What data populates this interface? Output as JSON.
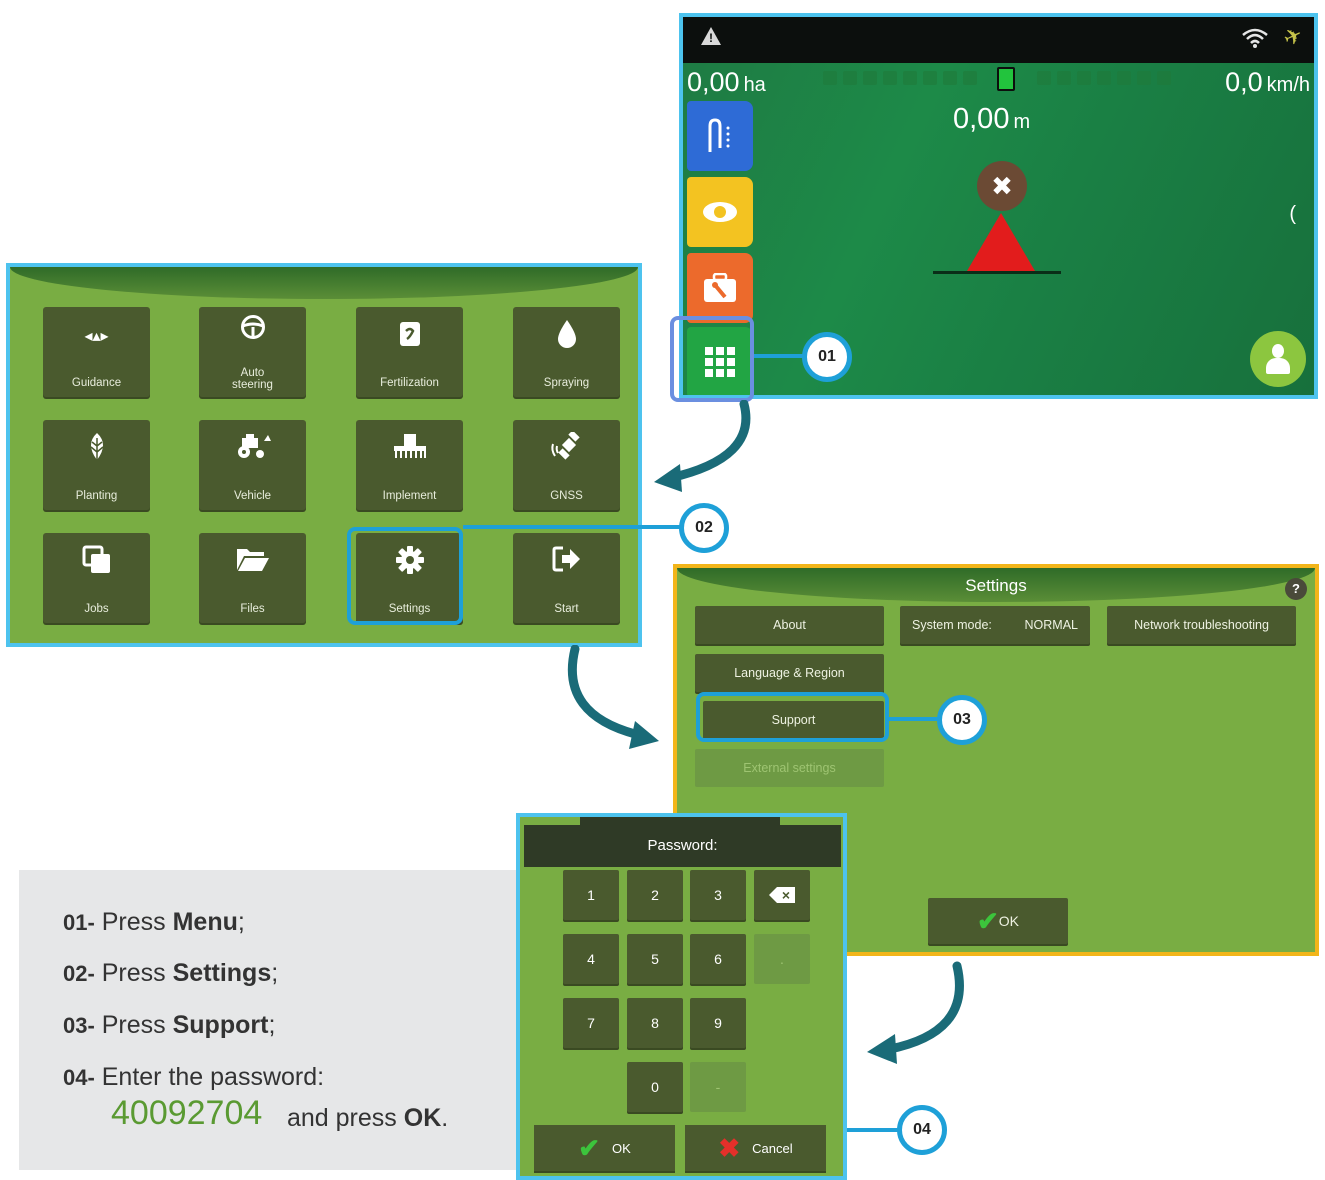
{
  "screen1": {
    "area_value": "0,00",
    "area_unit": "ha",
    "speed_value": "0,0",
    "speed_unit": "km/h",
    "crosstrack_value": "0,00",
    "crosstrack_unit": "m",
    "icons": [
      "warning-icon",
      "wifi-icon",
      "satellite-icon",
      "guidance-pattern-icon",
      "eye-icon",
      "toolbox-icon",
      "menu-grid-icon",
      "cancel-icon",
      "vehicle-triangle-icon",
      "operator-icon"
    ]
  },
  "menu": {
    "tiles": [
      {
        "label": "Guidance",
        "icon": "guidance-icon"
      },
      {
        "label": "Auto\nsteering",
        "icon": "steering-wheel-icon"
      },
      {
        "label": "Fertilization",
        "icon": "fertilizer-bag-icon"
      },
      {
        "label": "Spraying",
        "icon": "droplet-icon"
      },
      {
        "label": "Planting",
        "icon": "leaf-icon"
      },
      {
        "label": "Vehicle",
        "icon": "tractor-icon"
      },
      {
        "label": "Implement",
        "icon": "implement-icon"
      },
      {
        "label": "GNSS",
        "icon": "satellite-icon"
      },
      {
        "label": "Jobs",
        "icon": "jobs-icon"
      },
      {
        "label": "Files",
        "icon": "folder-icon"
      },
      {
        "label": "Settings",
        "icon": "gear-icon"
      },
      {
        "label": "Start",
        "icon": "exit-icon"
      }
    ]
  },
  "settings": {
    "title": "Settings",
    "help": "?",
    "about": "About",
    "system_mode_label": "System mode:",
    "system_mode_value": "NORMAL",
    "network": "Network troubleshooting",
    "language": "Language & Region",
    "support": "Support",
    "external": "External settings",
    "ok": "OK"
  },
  "password": {
    "title": "Password:",
    "keys": [
      "1",
      "2",
      "3",
      "4",
      "5",
      "6",
      ".",
      "7",
      "8",
      "9",
      "0",
      "-"
    ],
    "ok": "OK",
    "cancel": "Cancel"
  },
  "callouts": [
    "01",
    "02",
    "03",
    "04"
  ],
  "instructions": {
    "s1_num": "01-",
    "s1_pre": "Press ",
    "s1_bold": "Menu",
    "s1_post": ";",
    "s2_num": "02-",
    "s2_pre": "Press ",
    "s2_bold": "Settings",
    "s2_post": ";",
    "s3_num": "03-",
    "s3_pre": "Press ",
    "s3_bold": "Support",
    "s3_post": ";",
    "s4_num": "04-",
    "s4_pre": "Enter the password:",
    "code": "40092704",
    "s4_tail_pre": "and press ",
    "s4_tail_bold": "OK",
    "s4_tail_post": "."
  },
  "colors": {
    "highlight": "#1ea0d8",
    "screen_green": "#79ad43",
    "button_olive": "#4a5a2e",
    "settings_border": "#f2b51a",
    "code_green": "#5a9a32"
  }
}
